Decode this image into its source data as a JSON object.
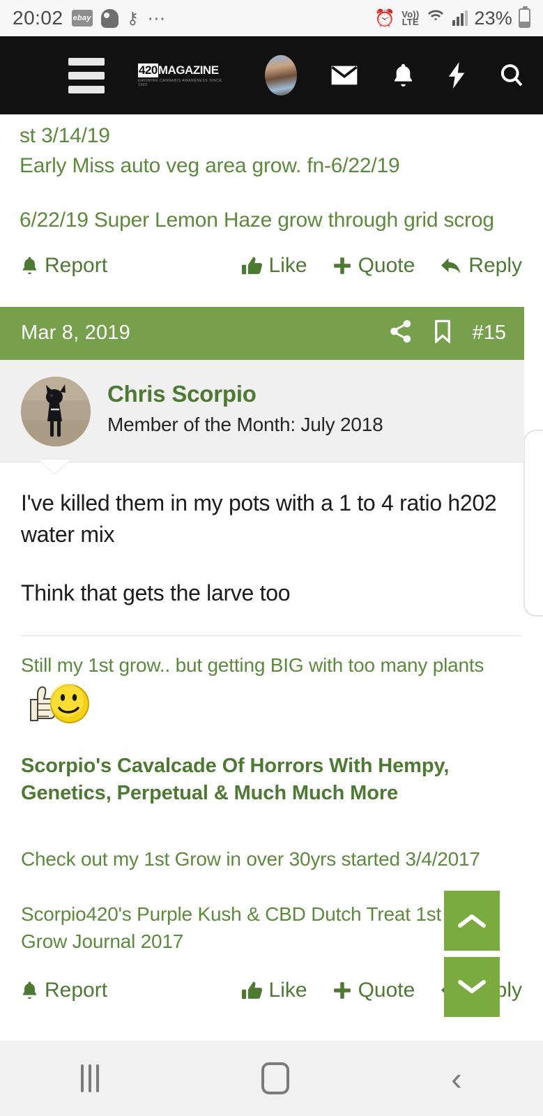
{
  "status_bar": {
    "time": "20:02",
    "battery_percent": "23%",
    "network_type": "Vo) LTE",
    "volte_top": "Vo))",
    "volte_bottom": "LTE",
    "icons": [
      "ebay-icon",
      "ghost-app-icon",
      "key-icon",
      "overflow-dots-icon",
      "alarm-icon",
      "volte-icon",
      "wifi-icon",
      "cellular-signal-icon",
      "battery-icon"
    ]
  },
  "navbar": {
    "logo_main": "420MAGAZINE",
    "logo_sub": "GROWING CANNABIS AWARENESS SINCE 1993",
    "icons": [
      "hamburger-menu-icon",
      "site-logo",
      "user-avatar",
      "mail-icon",
      "bell-icon",
      "lightning-icon",
      "search-icon"
    ]
  },
  "previous_post": {
    "signature_lines": [
      "st 3/14/19",
      "Early Miss auto veg area grow. fn-6/22/19"
    ],
    "signature_line_2": "6/22/19 Super Lemon Haze grow through grid scrog",
    "actions": {
      "report": "Report",
      "like": "Like",
      "quote": "Quote",
      "reply": "Reply"
    }
  },
  "post": {
    "header": {
      "date": "Mar 8, 2019",
      "post_number": "#15",
      "share_label": "share-icon",
      "bookmark_label": "bookmark-icon"
    },
    "author": {
      "name": "Chris Scorpio",
      "title": "Member of the Month: July 2018",
      "avatar_alt": "black dog photo avatar"
    },
    "body": {
      "paragraph_1": "I've killed them in my pots with a 1 to 4 ratio h202 water mix",
      "paragraph_2": "Think that gets the larve too"
    },
    "signature": {
      "line_1": "Still my 1st grow.. but getting BIG with too many plants",
      "emoticon": "thumbs-up-smiley-emoticon",
      "link_bold": "Scorpio's Cavalcade Of Horrors With Hempy, Genetics, Perpetual & Much Much More",
      "line_2": "Check out my 1st Grow in over 30yrs started 3/4/2017",
      "line_3": "Scorpio420's Purple Kush & CBD Dutch Treat 1st Time Grow Journal 2017"
    },
    "actions": {
      "report": "Report",
      "like": "Like",
      "quote": "Quote",
      "reply": "Reply"
    }
  },
  "scroll_buttons": {
    "up": "scroll-up-button",
    "down": "scroll-down-button"
  },
  "android_nav": {
    "recents": "recents-button",
    "home": "home-button",
    "back": "back-button"
  },
  "colors": {
    "brand_green": "#77a04c",
    "link_green": "#5c8a3c",
    "accent_green": "#7bab3f",
    "navbar_black": "#111111"
  }
}
